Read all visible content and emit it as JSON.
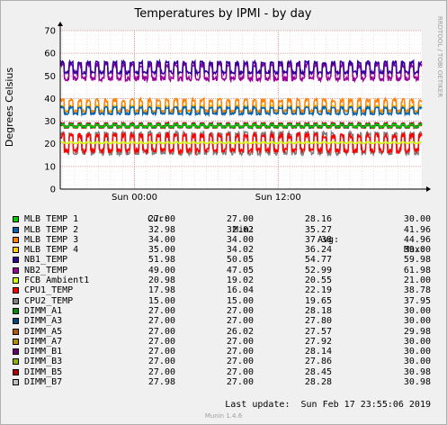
{
  "chart_data": {
    "type": "line",
    "title": "Temperatures by IPMI - by day",
    "ylabel": "Degrees Celsius",
    "xlabel": "",
    "ylim": [
      0,
      70
    ],
    "yticks": [
      0,
      10,
      20,
      30,
      40,
      50,
      60,
      70
    ],
    "x_start_hour": -6.2,
    "x_end_hour": 24,
    "xticks": [
      {
        "hour": 0,
        "label": "Sun 00:00"
      },
      {
        "hour": 12,
        "label": "Sun 12:00"
      }
    ],
    "grid": true,
    "watermark": "RRDTOOL / TOBI OETIKER",
    "series": [
      {
        "name": "MLB TEMP 1",
        "color": "#00cc00",
        "cur": "27.00",
        "min": "27.00",
        "avg": "28.16",
        "max": "30.00",
        "base": 28.0,
        "amp": 1.0,
        "drop": 0
      },
      {
        "name": "MLB TEMP 2",
        "color": "#0066b3",
        "cur": "32.98",
        "min": "32.02",
        "avg": "35.27",
        "max": "41.96",
        "base": 34.5,
        "amp": 2.5,
        "drop": 0
      },
      {
        "name": "MLB TEMP 3",
        "color": "#ff8000",
        "cur": "34.00",
        "min": "34.00",
        "avg": "37.38",
        "max": "44.96",
        "base": 36.5,
        "amp": 4.5,
        "drop": 0
      },
      {
        "name": "MLB TEMP 4",
        "color": "#ffcc00",
        "cur": "35.00",
        "min": "34.02",
        "avg": "36.24",
        "max": "39.00",
        "base": 35.5,
        "amp": 2.0,
        "drop": 0
      },
      {
        "name": "NB1_TEMP",
        "color": "#330099",
        "cur": "51.98",
        "min": "50.05",
        "avg": "54.77",
        "max": "59.98",
        "base": 53.5,
        "amp": 4.0,
        "drop": 0
      },
      {
        "name": "NB2_TEMP",
        "color": "#990099",
        "cur": "49.00",
        "min": "47.05",
        "avg": "52.99",
        "max": "61.98",
        "base": 51.5,
        "amp": 5.5,
        "drop": 0
      },
      {
        "name": "FCB Ambient1",
        "color": "#ccff00",
        "cur": "20.98",
        "min": "19.02",
        "avg": "20.55",
        "max": "21.00",
        "base": 20.5,
        "amp": 0.5,
        "drop": 0
      },
      {
        "name": "CPU1_TEMP",
        "color": "#ff0000",
        "cur": "17.98",
        "min": "16.04",
        "avg": "22.19",
        "max": "38.78",
        "base": 20.0,
        "amp": 6.0,
        "drop": 0
      },
      {
        "name": "CPU2_TEMP",
        "color": "#808080",
        "cur": "15.00",
        "min": "15.00",
        "avg": "19.65",
        "max": "37.95",
        "base": 19.0,
        "amp": 6.0,
        "drop": 1
      },
      {
        "name": "DIMM_A1",
        "color": "#008f00",
        "cur": "27.00",
        "min": "27.00",
        "avg": "28.18",
        "max": "30.00",
        "base": 28.0,
        "amp": 1.0,
        "drop": 0
      },
      {
        "name": "DIMM_A3",
        "color": "#00487d",
        "cur": "27.00",
        "min": "27.00",
        "avg": "27.80",
        "max": "30.00",
        "base": 27.8,
        "amp": 1.0,
        "drop": 0
      },
      {
        "name": "DIMM_A5",
        "color": "#b35a00",
        "cur": "27.00",
        "min": "26.02",
        "avg": "27.57",
        "max": "29.98",
        "base": 27.5,
        "amp": 1.0,
        "drop": 0
      },
      {
        "name": "DIMM_A7",
        "color": "#b38f00",
        "cur": "27.00",
        "min": "27.00",
        "avg": "27.92",
        "max": "30.00",
        "base": 27.9,
        "amp": 1.0,
        "drop": 0
      },
      {
        "name": "DIMM_B1",
        "color": "#6b006b",
        "cur": "27.00",
        "min": "27.00",
        "avg": "28.14",
        "max": "30.00",
        "base": 28.1,
        "amp": 1.0,
        "drop": 0
      },
      {
        "name": "DIMM_B3",
        "color": "#8fb300",
        "cur": "27.00",
        "min": "27.00",
        "avg": "27.86",
        "max": "30.00",
        "base": 27.8,
        "amp": 1.0,
        "drop": 0
      },
      {
        "name": "DIMM_B5",
        "color": "#b30000",
        "cur": "27.00",
        "min": "27.00",
        "avg": "28.45",
        "max": "30.98",
        "base": 28.4,
        "amp": 1.2,
        "drop": 0
      },
      {
        "name": "DIMM_B7",
        "color": "#bebebe",
        "cur": "27.98",
        "min": "27.00",
        "avg": "28.28",
        "max": "30.98",
        "base": 28.2,
        "amp": 1.2,
        "drop": 0
      }
    ]
  },
  "legend": {
    "headers": {
      "cur": "Cur:",
      "min": "Min:",
      "avg": "Avg:",
      "max": "Max:"
    }
  },
  "footer": {
    "last_update": "Last update:  Sun Feb 17 23:55:06 2019",
    "version": "Munin 1.4.6"
  }
}
